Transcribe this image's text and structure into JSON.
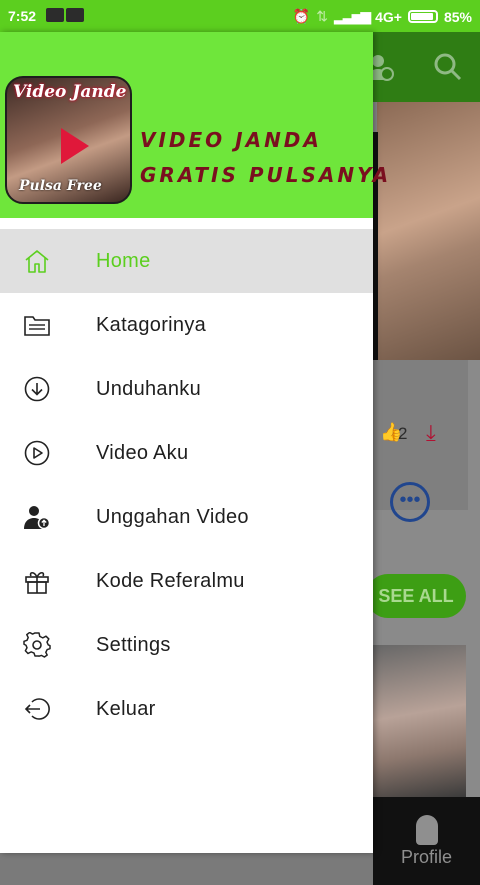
{
  "status_bar": {
    "time": "7:52",
    "network": "4G+",
    "battery": "85%"
  },
  "drawer": {
    "logo": {
      "title": "Video Jande",
      "subtitle": "Pulsa Free"
    },
    "brand": {
      "line1": "VIDEO JANDA",
      "line2": "GRATIS PULSANYA"
    },
    "menu": [
      {
        "label": "Home",
        "icon": "home-icon",
        "active": true
      },
      {
        "label": "Katagorinya",
        "icon": "folder-icon"
      },
      {
        "label": "Unduhanku",
        "icon": "download-circle-icon"
      },
      {
        "label": "Video Aku",
        "icon": "play-circle-icon"
      },
      {
        "label": "Unggahan Video",
        "icon": "user-upload-icon"
      },
      {
        "label": "Kode Referalmu",
        "icon": "gift-icon"
      },
      {
        "label": "Settings",
        "icon": "gear-icon"
      },
      {
        "label": "Keluar",
        "icon": "logout-icon"
      }
    ]
  },
  "background": {
    "like_count": "2",
    "see_all": "SEE ALL",
    "bottom_nav_profile": "Profile"
  },
  "colors": {
    "accent": "#5ccf1f",
    "header": "#6fe63b",
    "brand_text": "#7a0f1f"
  }
}
